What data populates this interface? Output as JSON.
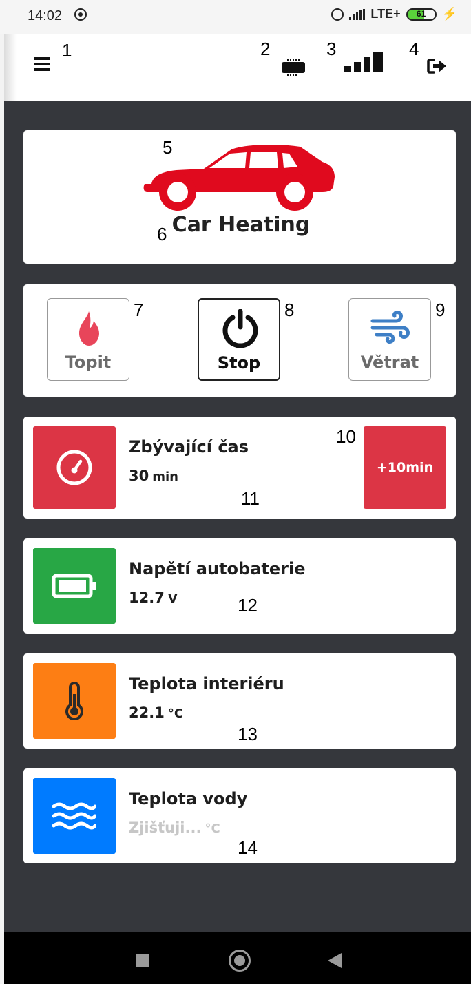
{
  "status_bar": {
    "time": "14:02",
    "network": "LTE+",
    "battery_percent": "61"
  },
  "annotations": {
    "a1": "1",
    "a2": "2",
    "a3": "3",
    "a4": "4",
    "a5": "5",
    "a6": "6",
    "a7": "7",
    "a8": "8",
    "a9": "9",
    "a10": "10",
    "a11": "11",
    "a12": "12",
    "a13": "13",
    "a14": "14"
  },
  "app_bar": {
    "icons": [
      "menu-icon",
      "chip-icon",
      "signal-strength-icon",
      "logout-icon"
    ],
    "signal_level": 0.8
  },
  "hero": {
    "icon": "car-icon",
    "title": "Car Heating",
    "accent": "#e00a1e"
  },
  "controls": [
    {
      "label": "Topit",
      "icon": "flame-icon",
      "color": "#e8455a"
    },
    {
      "label": "Stop",
      "icon": "power-icon",
      "color": "#111111",
      "active": true
    },
    {
      "label": "Větrat",
      "icon": "wind-icon",
      "color": "#3e7fc6"
    }
  ],
  "remaining_time": {
    "title": "Zbývající čas",
    "value": "30",
    "unit": "min",
    "icon": "gauge-icon",
    "color": "#dc3545",
    "extend_button": "+10min"
  },
  "battery_voltage": {
    "title": "Napětí autobaterie",
    "value": "12.7",
    "unit": "V",
    "icon": "battery-icon",
    "color": "#28a745"
  },
  "interior_temp": {
    "title": "Teplota interiéru",
    "value": "22.1",
    "unit": "°C",
    "icon": "thermometer-icon",
    "color": "#fd7e14"
  },
  "water_temp": {
    "title": "Teplota vody",
    "value": "Zjišťuji...",
    "unit": "°C",
    "icon": "water-icon",
    "color": "#007bff"
  },
  "nav_bar": {
    "icons": [
      "recents-icon",
      "home-icon",
      "back-icon"
    ]
  }
}
